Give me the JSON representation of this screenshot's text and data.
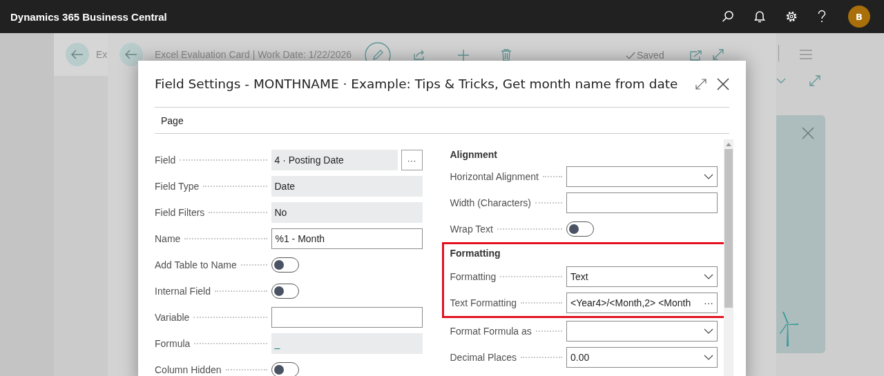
{
  "app": {
    "title": "Dynamics 365 Business Central",
    "avatar": "B"
  },
  "back_page": {
    "title": "Ex"
  },
  "page": {
    "title": "Excel Evaluation Card | Work Date: 1/22/2026",
    "status": "Saved"
  },
  "dialog": {
    "title": "Field Settings - MONTHNAME · Example: Tips & Tricks, Get month name from date",
    "action": "Page",
    "left_fields": [
      {
        "kind": "lookup",
        "label": "Field",
        "value": "4 · Posting Date",
        "button": "···"
      },
      {
        "kind": "readonly",
        "label": "Field Type",
        "value": "Date"
      },
      {
        "kind": "readonly",
        "label": "Field Filters",
        "value": "No"
      },
      {
        "kind": "text",
        "label": "Name",
        "value": "%1 - Month"
      },
      {
        "kind": "toggle",
        "label": "Add Table to Name",
        "checked": false
      },
      {
        "kind": "toggle",
        "label": "Internal Field",
        "checked": false
      },
      {
        "kind": "text",
        "label": "Variable"
      },
      {
        "kind": "link",
        "label": "Formula",
        "value": "_"
      },
      {
        "kind": "toggle",
        "label": "Column Hidden",
        "checked": false
      }
    ],
    "right_groups": [
      {
        "heading": "Alignment",
        "highlighted": false,
        "fields": [
          {
            "kind": "dropdown",
            "label": "Horizontal Alignment"
          },
          {
            "kind": "text",
            "label": "Width (Characters)"
          },
          {
            "kind": "toggle",
            "label": "Wrap Text",
            "checked": false
          }
        ]
      },
      {
        "heading": "Formatting",
        "highlighted": true,
        "fields": [
          {
            "kind": "dropdown",
            "label": "Formatting",
            "value": "Text"
          },
          {
            "kind": "assist",
            "label": "Text Formatting",
            "value": "<Year4>/<Month,2> <Month",
            "button": "···"
          }
        ]
      },
      {
        "highlighted": false,
        "fields": [
          {
            "kind": "dropdown",
            "label": "Format Formula as"
          },
          {
            "kind": "dropdown",
            "label": "Decimal Places",
            "value": "0.00"
          }
        ]
      }
    ]
  }
}
